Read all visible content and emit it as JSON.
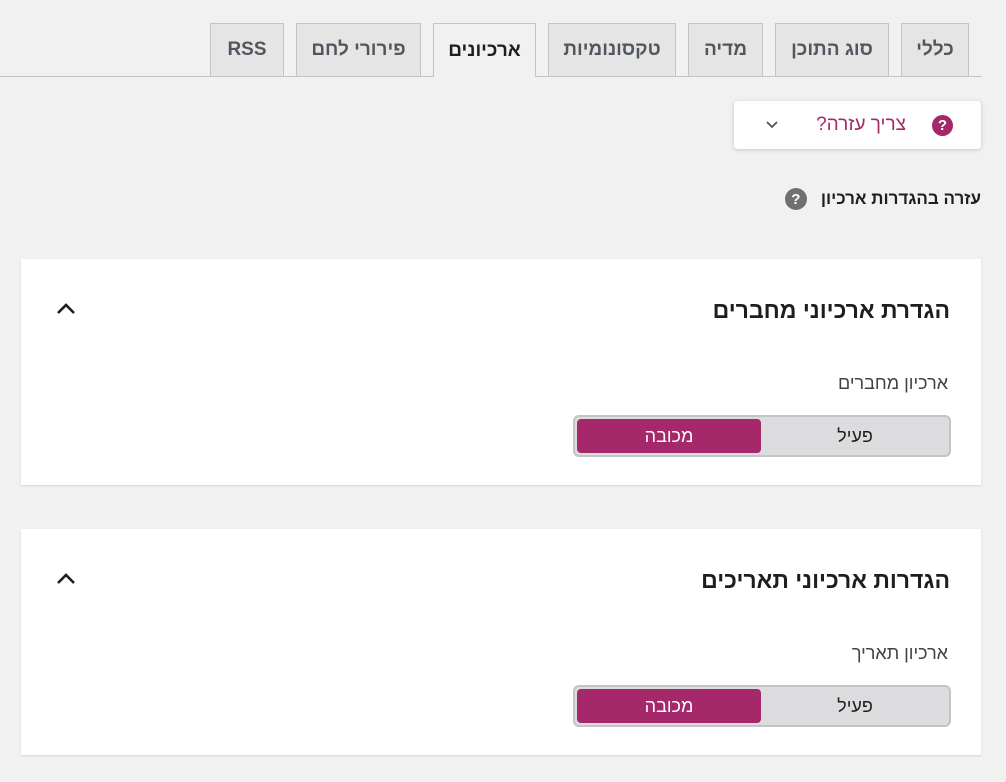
{
  "tabs": [
    {
      "label": "כללי"
    },
    {
      "label": "סוג התוכן"
    },
    {
      "label": "מדיה"
    },
    {
      "label": "טקסונומיות"
    },
    {
      "label": "ארכיונים",
      "active": true
    },
    {
      "label": "פירורי לחם"
    },
    {
      "label": "RSS"
    }
  ],
  "help": {
    "toggle_label": "צריך עזרה?",
    "icon": "question-circle-icon",
    "archive_help_label": "עזרה בהגדרות ארכיון"
  },
  "cards": [
    {
      "title": "הגדרת ארכיוני מחברים",
      "field_label": "ארכיון מחברים",
      "toggle": {
        "on_label": "פעיל",
        "off_label": "מכובה",
        "selected": "off"
      }
    },
    {
      "title": "הגדרות ארכיוני תאריכים",
      "field_label": "ארכיון תאריך",
      "toggle": {
        "on_label": "פעיל",
        "off_label": "מכובה",
        "selected": "off"
      }
    }
  ],
  "colors": {
    "accent": "#a4286a",
    "background": "#f1f1f1"
  }
}
